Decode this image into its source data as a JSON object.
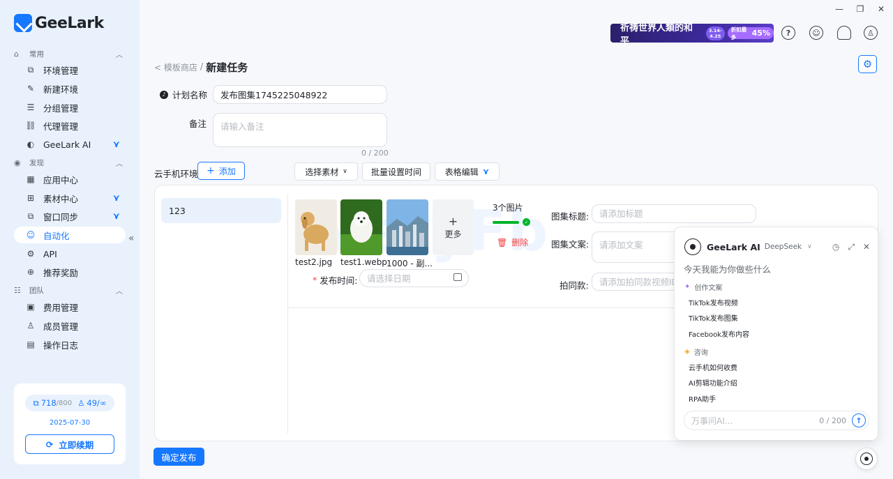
{
  "app": {
    "logo_text": "GeeLark"
  },
  "window_controls": {
    "minimize": "—",
    "restore": "❐",
    "close": "✕"
  },
  "banner": {
    "text": "祈祷世界人類的和平",
    "date_line1": "3.14-",
    "date_line2": "4.25",
    "tag_text": "折扣最多",
    "tag_value": "45%"
  },
  "sidebar": {
    "sections": [
      {
        "label": "常用",
        "icon": "⌂",
        "caret": "︿"
      },
      {
        "label": "发现",
        "icon": "◉",
        "caret": "︿"
      },
      {
        "label": "团队",
        "icon": "☷",
        "caret": "︿"
      }
    ],
    "items": [
      {
        "label": "环境管理",
        "icon": "⧉"
      },
      {
        "label": "新建环境",
        "icon": "✎"
      },
      {
        "label": "分组管理",
        "icon": "☰"
      },
      {
        "label": "代理管理",
        "icon": "⛓"
      },
      {
        "label": "GeeLark AI",
        "icon": "◐",
        "badge": "⋎"
      },
      {
        "label": "应用中心",
        "icon": "▦"
      },
      {
        "label": "素材中心",
        "icon": "⊞",
        "badge": "⋎"
      },
      {
        "label": "窗口同步",
        "icon": "⧉",
        "badge": "⋎"
      },
      {
        "label": "自动化",
        "icon": "☺"
      },
      {
        "label": "API",
        "icon": "⚙"
      },
      {
        "label": "推荐奖励",
        "icon": "⊕"
      },
      {
        "label": "费用管理",
        "icon": "▣"
      },
      {
        "label": "成员管理",
        "icon": "♙"
      },
      {
        "label": "操作日志",
        "icon": "▤"
      }
    ],
    "collapse": "«",
    "usage": {
      "envs_used": "718",
      "envs_total": "/800",
      "members": "49/",
      "members_total": "∞",
      "expiry": "2025-07-30",
      "renew_label": "立即续期"
    }
  },
  "header": {
    "back": "< 模板商店",
    "sep": "/",
    "title": "新建任务"
  },
  "form": {
    "plan_name_label": "计划名称",
    "plan_name_value": "发布图集1745225048922",
    "remark_label": "备注",
    "remark_placeholder": "请输入备注",
    "remark_count": "0 / 200",
    "env_label": "云手机环境",
    "add_label": "添加",
    "choose_material": "选择素材",
    "batch_time": "批量设置时间",
    "table_edit": "表格编辑"
  },
  "panel": {
    "env_item": "123",
    "thumbs": [
      {
        "caption": "test2.jpg",
        "kind": "dog"
      },
      {
        "caption": "test1.webp",
        "kind": "puppy"
      },
      {
        "caption": "1000 - 副...",
        "kind": "city"
      }
    ],
    "more_label": "更多",
    "more_plus": "+",
    "count_label": "3个图片",
    "delete_label": "删除",
    "publish_time_label": "发布时间:",
    "date_placeholder": "请选择日期",
    "album_title_label": "图集标题:",
    "album_title_placeholder": "请添加标题",
    "album_text_label": "图集文案:",
    "album_text_placeholder": "请添加文案",
    "same_label": "拍同款:",
    "same_placeholder": "请添加拍同款视频ID或者链接",
    "watermark": "VeryFb"
  },
  "submit_label": "确定发布",
  "ai": {
    "title": "GeeLark AI",
    "model": "DeepSeek",
    "greeting": "今天我能为你做些什么",
    "cat1": "创作文案",
    "cat1_items": [
      "TikTok发布视频",
      "TikTok发布图集",
      "Facebook发布内容"
    ],
    "cat2": "咨询",
    "cat2_items": [
      "云手机如何收费",
      "AI剪辑功能介绍",
      "RPA助手"
    ],
    "input_placeholder": "万事问AI...",
    "input_count": "0 / 200"
  },
  "colors": {
    "accent": "#1677ff",
    "sidebar_bg": "#e9f2fc",
    "danger": "#f53f3f",
    "success": "#00b42a"
  }
}
